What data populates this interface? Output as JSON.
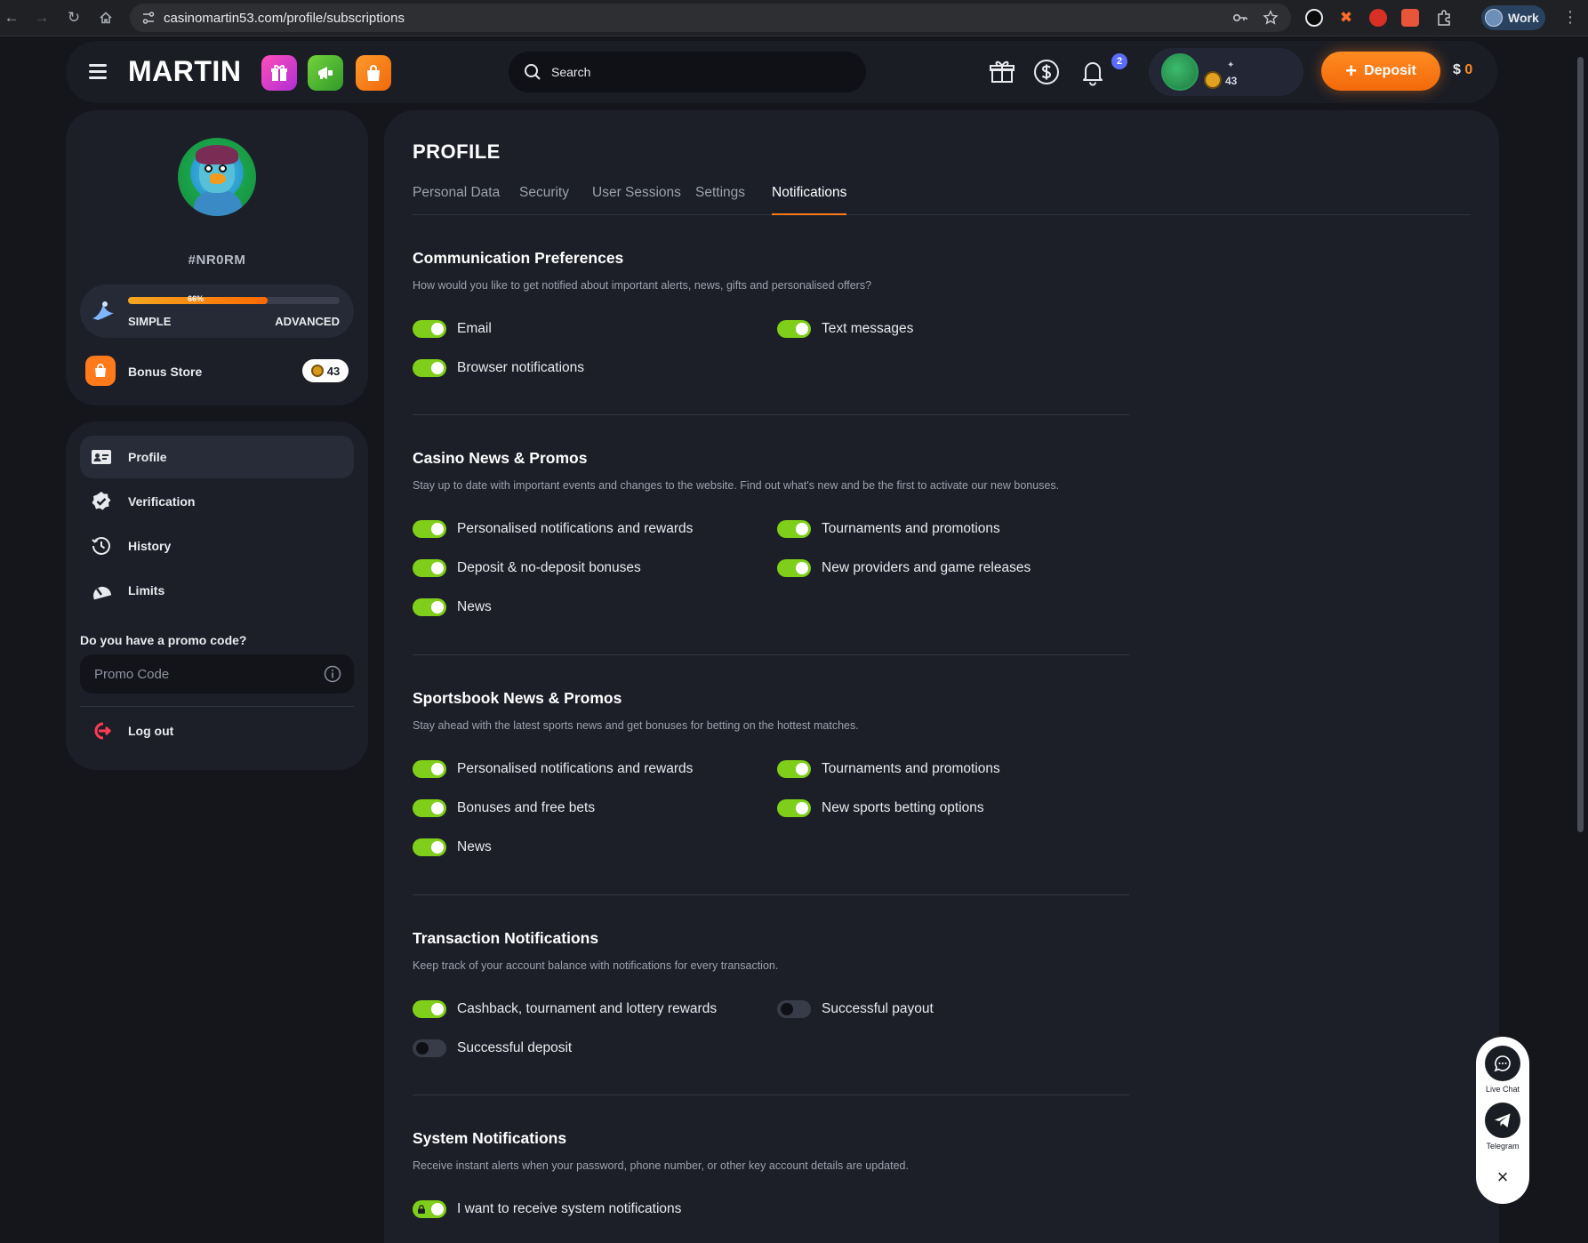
{
  "browser": {
    "url": "casinomartin53.com/profile/subscriptions",
    "profile_label": "Work"
  },
  "header": {
    "logo": "MARTIN",
    "search_placeholder": "Search",
    "wallet_badge_count": "2",
    "coins": "43",
    "deposit_label": "Deposit",
    "balance_currency": "$",
    "balance_amount": "0"
  },
  "sidebar": {
    "user_id": "#NR0RM",
    "level_progress_label": "66%",
    "level_progress": 0.66,
    "level_left": "SIMPLE",
    "level_right": "ADVANCED",
    "bonus_store_label": "Bonus Store",
    "bonus_store_count": "43",
    "menu": [
      {
        "label": "Profile",
        "icon": "id-card-icon",
        "active": true
      },
      {
        "label": "Verification",
        "icon": "check-badge-icon",
        "active": false
      },
      {
        "label": "History",
        "icon": "history-clock-icon",
        "active": false
      },
      {
        "label": "Limits",
        "icon": "gauge-icon",
        "active": false
      }
    ],
    "promo_question": "Do you have a promo code?",
    "promo_placeholder": "Promo Code",
    "logout_label": "Log out"
  },
  "profile": {
    "title": "PROFILE",
    "tabs": [
      "Personal Data",
      "Security",
      "User Sessions",
      "Settings",
      "Notifications"
    ],
    "active_tab": "Notifications",
    "sections": [
      {
        "title": "Communication Preferences",
        "description": "How would you like to get notified about important alerts, news, gifts and personalised offers?",
        "toggles": [
          {
            "label": "Email",
            "on": true
          },
          {
            "label": "Text messages",
            "on": true
          },
          {
            "label": "Browser notifications",
            "on": true
          }
        ]
      },
      {
        "title": "Casino News & Promos",
        "description": "Stay up to date with important events and changes to the website. Find out what's new and be the first to activate our new bonuses.",
        "toggles": [
          {
            "label": "Personalised notifications and rewards",
            "on": true
          },
          {
            "label": "Tournaments and promotions",
            "on": true
          },
          {
            "label": "Deposit & no-deposit bonuses",
            "on": true
          },
          {
            "label": "New providers and game releases",
            "on": true
          },
          {
            "label": "News",
            "on": true
          }
        ]
      },
      {
        "title": "Sportsbook News & Promos",
        "description": "Stay ahead with the latest sports news and get bonuses for betting on the hottest matches.",
        "toggles": [
          {
            "label": "Personalised notifications and rewards",
            "on": true
          },
          {
            "label": "Tournaments and promotions",
            "on": true
          },
          {
            "label": "Bonuses and free bets",
            "on": true
          },
          {
            "label": "New sports betting options",
            "on": true
          },
          {
            "label": "News",
            "on": true
          }
        ]
      },
      {
        "title": "Transaction Notifications",
        "description": "Keep track of your account balance with notifications for every transaction.",
        "toggles": [
          {
            "label": "Cashback, tournament and lottery rewards",
            "on": true
          },
          {
            "label": "Successful payout",
            "on": false
          },
          {
            "label": "Successful deposit",
            "on": false
          }
        ]
      },
      {
        "title": "System Notifications",
        "description": "Receive instant alerts when your password, phone number, or other key account details are updated.",
        "toggles": [
          {
            "label": "I want to receive system notifications",
            "on": true,
            "locked": true
          }
        ]
      }
    ]
  },
  "widget": {
    "live_chat_label": "Live Chat",
    "telegram_label": "Telegram"
  },
  "colors": {
    "accent": "#ff7a1a",
    "toggle_on": "#7fcf1a",
    "toggle_off": "#383c48",
    "panel": "#1c1f28",
    "background": "#14161c"
  }
}
